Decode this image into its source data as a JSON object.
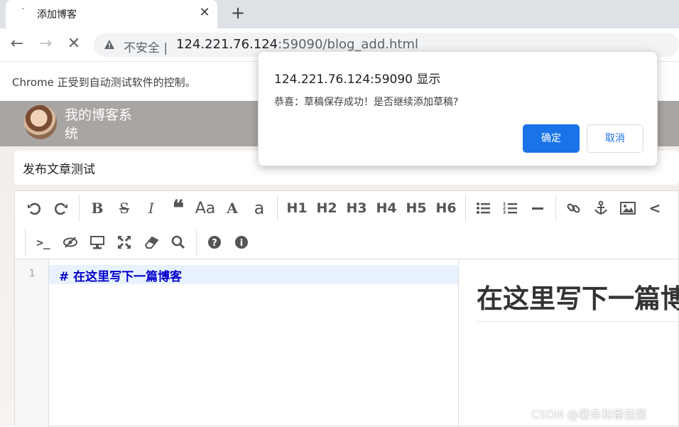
{
  "browser": {
    "tab_title": "添加博客",
    "tab_close": "✕",
    "new_tab": "+",
    "insecure_label": "不安全",
    "url_host": "124.221.76.124",
    "url_rest": ":59090/blog_add.html",
    "infobar_text": "Chrome 正受到自动测试软件的控制。"
  },
  "blog": {
    "site_title": "我的博客系统",
    "article_title": "发布文章测试"
  },
  "editor": {
    "toolbar_row1": {
      "headings": [
        "H1",
        "H2",
        "H3",
        "H4",
        "H5",
        "H6"
      ],
      "font_size_label": "Aa",
      "uppercase_label": "A",
      "lowercase_label": "a"
    },
    "line_number": "1",
    "markdown_line": "#  在这里写下一篇博客",
    "preview_heading": "在这里写下一篇博客"
  },
  "dialog": {
    "title": "124.221.76.124:59090 显示",
    "message": "恭喜：草稿保存成功！是否继续添加草稿?",
    "ok_label": "确定",
    "cancel_label": "取消"
  },
  "watermark": "CSDN @薯条和番茄酱",
  "colors": {
    "accent": "#1a73e8",
    "header_bg": "#a9a5a3",
    "md_heading": "#0000cc"
  }
}
